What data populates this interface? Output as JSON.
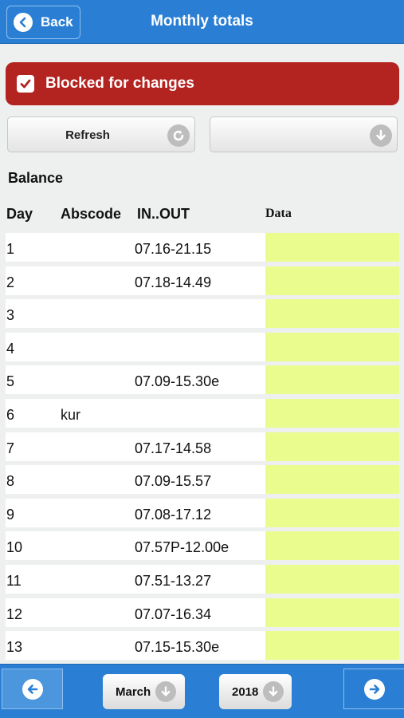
{
  "nav": {
    "back_label": "Back",
    "title": "Monthly totals"
  },
  "banner": {
    "label": "Blocked for changes",
    "checked": true,
    "color": "#b32320"
  },
  "toolbar": {
    "refresh_label": "Refresh",
    "select_value": ""
  },
  "section_title": "Balance",
  "table": {
    "headers": {
      "day": "Day",
      "abscode": "Abscode",
      "inout": "IN..OUT",
      "data": "Data"
    },
    "rows": [
      {
        "day": "1",
        "abscode": "",
        "inout": "07.16-21.15"
      },
      {
        "day": "2",
        "abscode": "",
        "inout": "07.18-14.49"
      },
      {
        "day": "3",
        "abscode": "",
        "inout": ""
      },
      {
        "day": "4",
        "abscode": "",
        "inout": ""
      },
      {
        "day": "5",
        "abscode": "",
        "inout": "07.09-15.30e"
      },
      {
        "day": "6",
        "abscode": "kur",
        "inout": ""
      },
      {
        "day": "7",
        "abscode": "",
        "inout": "07.17-14.58"
      },
      {
        "day": "8",
        "abscode": "",
        "inout": "07.09-15.57"
      },
      {
        "day": "9",
        "abscode": "",
        "inout": "07.08-17.12"
      },
      {
        "day": "10",
        "abscode": "",
        "inout": "07.57P-12.00e"
      },
      {
        "day": "11",
        "abscode": "",
        "inout": "07.51-13.27"
      },
      {
        "day": "12",
        "abscode": "",
        "inout": "07.07-16.34"
      },
      {
        "day": "13",
        "abscode": "",
        "inout": "07.15-15.30e"
      }
    ]
  },
  "footer": {
    "month": "March",
    "year": "2018"
  },
  "colors": {
    "accent": "#2a7fd4",
    "data_cell": "#eafc8e",
    "alert": "#b32320"
  }
}
